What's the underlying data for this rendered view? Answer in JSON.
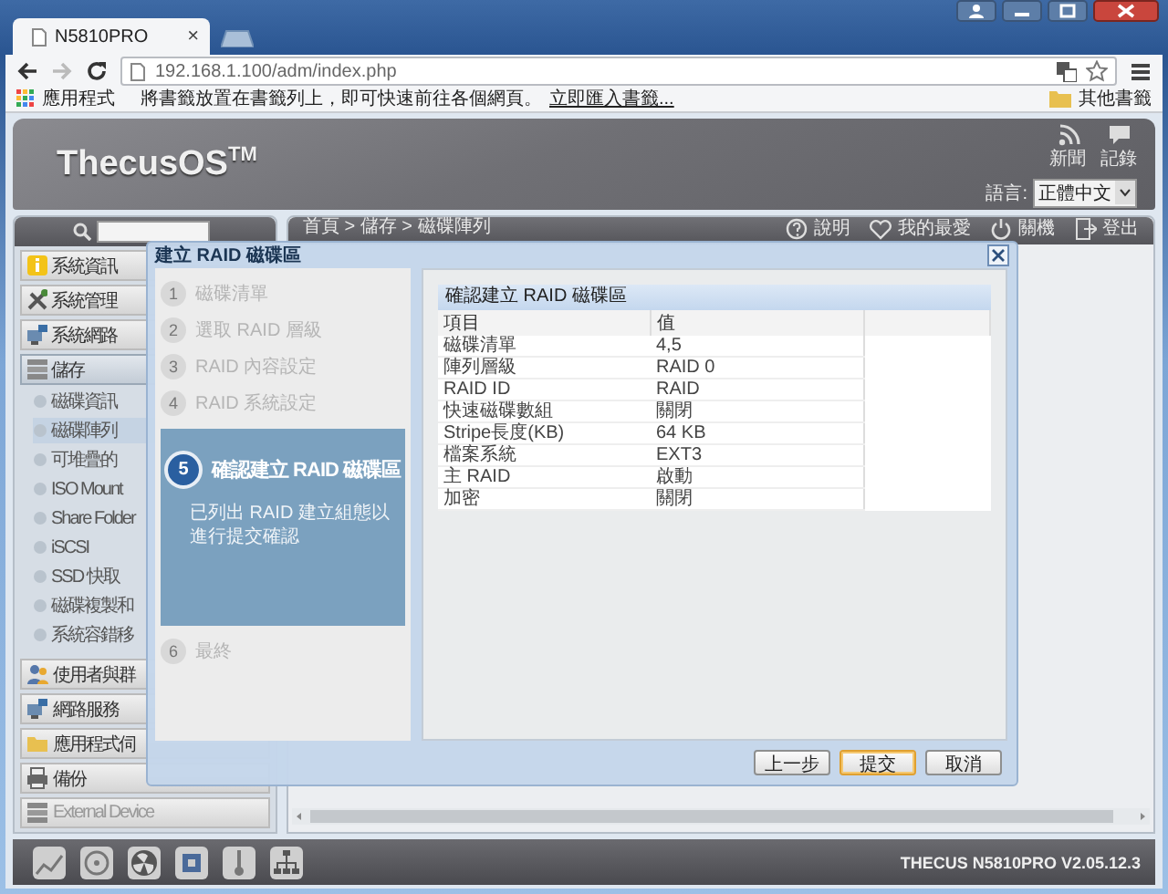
{
  "browser": {
    "tab": {
      "title": "N5810PRO",
      "close": "×"
    },
    "address": "192.168.1.100/adm/index.php",
    "bookmarks": {
      "apps": "應用程式",
      "hint": "將書籤放置在書籤列上，即可快速前往各個網頁。",
      "import_link": "立即匯入書籤...",
      "other": "其他書籤"
    }
  },
  "header": {
    "logo": "ThecusOS$^{TM}$",
    "links": [
      {
        "label": "新聞",
        "kind": "rss"
      },
      {
        "label": "記錄",
        "kind": "log"
      }
    ],
    "language_label": "語言:",
    "language": "正體中文"
  },
  "sidebar": {
    "items": [
      {
        "label": "系統資訊",
        "kind": "info",
        "expanded": false
      },
      {
        "label": "系統管理",
        "kind": "tools",
        "expanded": false
      },
      {
        "label": "系統網路",
        "kind": "network",
        "expanded": false
      },
      {
        "label": "儲存",
        "kind": "storage",
        "expanded": true,
        "children": [
          {
            "label": "磁碟資訊",
            "selected": false
          },
          {
            "label": "磁碟陣列",
            "selected": true
          },
          {
            "label": "可堆疊的",
            "selected": false
          },
          {
            "label": "ISO Mount",
            "selected": false
          },
          {
            "label": "Share Folder",
            "selected": false
          },
          {
            "label": "iSCSI",
            "selected": false
          },
          {
            "label": "SSD 快取",
            "selected": false
          },
          {
            "label": "磁碟複製和",
            "selected": false
          },
          {
            "label": "系統容錯移",
            "selected": false
          }
        ]
      }
    ],
    "bottom_items": [
      {
        "label": "使用者與群",
        "kind": "users",
        "disabled": false
      },
      {
        "label": "網路服務",
        "kind": "network",
        "disabled": false
      },
      {
        "label": "應用程式伺",
        "kind": "folder",
        "disabled": false
      },
      {
        "label": "備份",
        "kind": "backup",
        "disabled": false
      },
      {
        "label": "External Device",
        "kind": "storage",
        "disabled": true
      }
    ]
  },
  "main": {
    "breadcrumb": "首頁 > 儲存 > 磁碟陣列",
    "actions": [
      {
        "label": "說明",
        "kind": "help"
      },
      {
        "label": "我的最愛",
        "kind": "favorite"
      },
      {
        "label": "關機",
        "kind": "power"
      },
      {
        "label": "登出",
        "kind": "logout"
      }
    ]
  },
  "dialog": {
    "title": "建立 RAID 磁碟區",
    "steps": [
      {
        "number": "1",
        "label": "磁碟清單",
        "selected": false
      },
      {
        "number": "2",
        "label": "選取 RAID 層級",
        "selected": false
      },
      {
        "number": "3",
        "label": "RAID 內容設定",
        "selected": false
      },
      {
        "number": "4",
        "label": "RAID 系統設定",
        "selected": false
      },
      {
        "number": "5",
        "label": "確認建立 RAID 磁碟區",
        "selected": true,
        "description": "已列出 RAID 建立組態以進行提交確認"
      },
      {
        "number": "6",
        "label": "最終",
        "selected": false
      }
    ],
    "panel_title": "確認建立 RAID 磁碟區",
    "columns": [
      "項目",
      "值"
    ],
    "rows": [
      [
        "磁碟清單",
        "4,5"
      ],
      [
        "陣列層級",
        "RAID 0"
      ],
      [
        "RAID ID",
        "RAID"
      ],
      [
        "快速磁碟數組",
        "關閉"
      ],
      [
        "Stripe長度(KB)",
        "64 KB"
      ],
      [
        "檔案系統",
        "EXT3"
      ],
      [
        "主 RAID",
        "啟動"
      ],
      [
        "加密",
        "關閉"
      ]
    ],
    "buttons": [
      {
        "label": "上一步",
        "focused": false
      },
      {
        "label": "提交",
        "focused": true
      },
      {
        "label": "取消",
        "focused": false
      }
    ]
  },
  "footer": {
    "icons": [
      {
        "kind": "chart"
      },
      {
        "kind": "disk"
      },
      {
        "kind": "fan"
      },
      {
        "kind": "chip"
      },
      {
        "kind": "thermometer"
      },
      {
        "kind": "network"
      }
    ],
    "version": "THECUS N5810PRO V2.05.12.3"
  }
}
